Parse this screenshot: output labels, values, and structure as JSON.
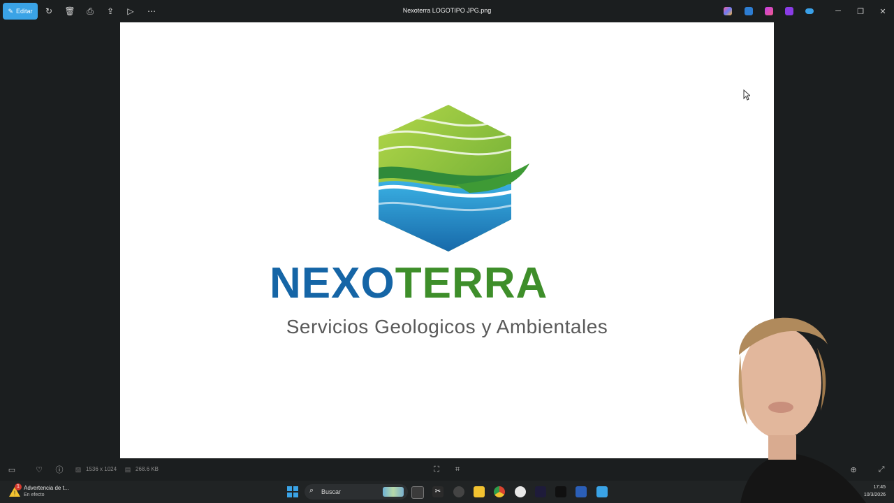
{
  "toolbar": {
    "edit_label": "Editar",
    "icons": [
      "rotate-icon",
      "delete-icon",
      "print-icon",
      "share-icon",
      "slideshow-icon",
      "more-icon"
    ]
  },
  "window": {
    "title": "Nexoterra LOGOTIPO JPG.png"
  },
  "logo": {
    "title_part1": "NexoTerra",
    "title_blue": "NEXO",
    "title_green": "TERRA",
    "subtitle": "Servicios Geologicos y Ambientales",
    "colors": {
      "blue": "#1565a6",
      "green": "#3e8e2a",
      "light_green": "#8cc63f",
      "light_blue": "#29a3dc"
    }
  },
  "statusbar": {
    "dimensions": "1536 x 1024",
    "file_size": "268.6 KB"
  },
  "taskbar": {
    "notification_title": "Advertencia de t...",
    "notification_sub": "En efecto",
    "notification_badge": "1",
    "search_placeholder": "Buscar",
    "time": "17:45",
    "date": "10/3/2026"
  }
}
